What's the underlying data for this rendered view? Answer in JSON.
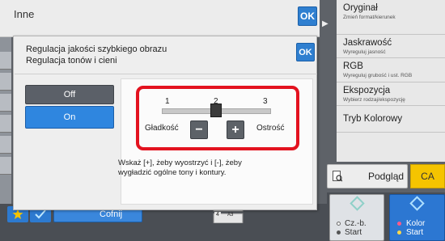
{
  "base_screen": {
    "title": "Inne",
    "ok_label": "OK"
  },
  "right_panel": {
    "items": [
      {
        "title": "Oryginał",
        "subtitle": "Zmień format/kierunek"
      },
      {
        "title": "Jaskrawość",
        "subtitle": "Wyreguluj jasność"
      },
      {
        "title": "RGB",
        "subtitle": "Wyreguluj grubość i ust. RGB"
      },
      {
        "title": "Ekspozycja",
        "subtitle": "Wybierz rodzaj/ekspozycję"
      },
      {
        "title": "Tryb Kolorowy",
        "subtitle": ""
      }
    ],
    "preview_label": "Podgląd",
    "ca_label": "CA",
    "start_bw_lines": [
      "Cz.-b.",
      "Start"
    ],
    "start_color_lines": [
      "Kolor",
      "Start"
    ]
  },
  "bottom_bar": {
    "undo_label": "Cofnij",
    "tray_number": "4",
    "tray_size": "A3"
  },
  "modal": {
    "title_line1": "Regulacja jakości szybkiego obrazu",
    "title_line2": "Regulacja tonów i cieni",
    "ok_label": "OK",
    "off_label": "Off",
    "on_label": "On",
    "selected_option": "On",
    "slider": {
      "ticks": [
        "1",
        "2",
        "3"
      ],
      "value": 2,
      "left_label": "Gładkość",
      "right_label": "Ostrość",
      "minus_label": "−",
      "plus_label": "+"
    },
    "hint_line1": "Wskaż [+], żeby wyostrzyć i [-], żeby",
    "hint_line2": "wygładzić ogólne tony i kontury."
  },
  "colors": {
    "accent_blue": "#2f86df",
    "highlight_red": "#e3121f",
    "ca_yellow": "#f5c400"
  }
}
